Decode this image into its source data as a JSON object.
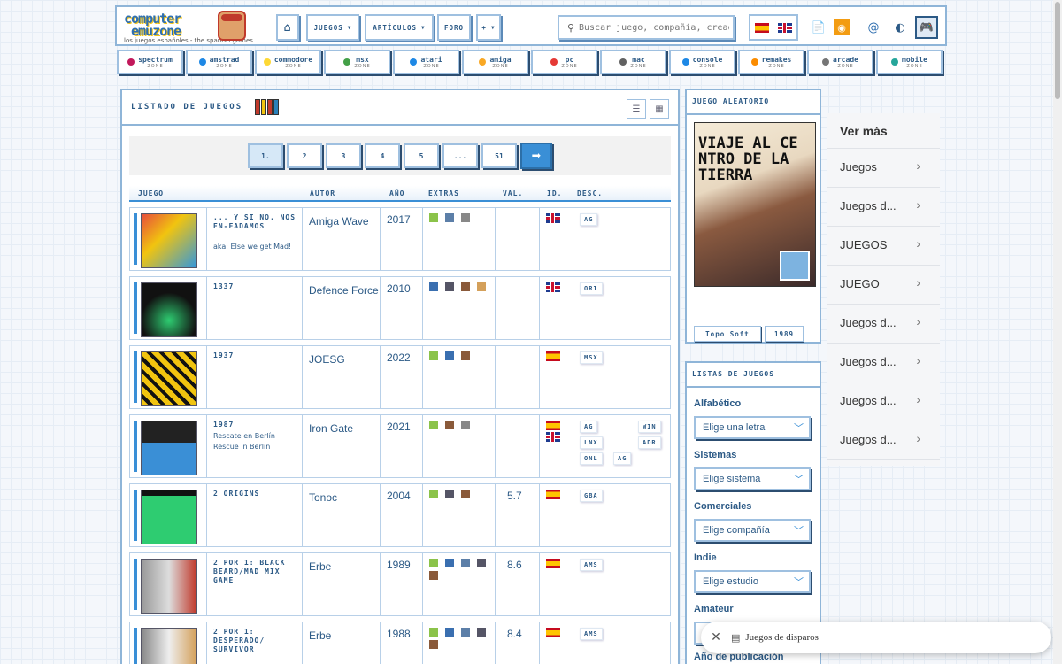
{
  "logo": {
    "line1": "computer",
    "line2": "emuzone",
    "tagline": "los juegos españoles - the spanish games"
  },
  "nav": {
    "home_icon": "home-icon",
    "juegos": "JUEGOS",
    "articulos": "ARTÍCULOS",
    "foro": "FORO",
    "mas": "+"
  },
  "search": {
    "placeholder": "Buscar juego, compañía, creador..."
  },
  "header_icons": [
    "translate-icon",
    "rss-icon",
    "email-icon",
    "contrast-icon",
    "gamepad-icon"
  ],
  "zones": [
    {
      "name": "spectrum",
      "sub": "ZONE",
      "color": "#c2185b"
    },
    {
      "name": "amstrad",
      "sub": "ZONE",
      "color": "#1e88e5"
    },
    {
      "name": "commodore",
      "sub": "ZONE",
      "color": "#fdd835"
    },
    {
      "name": "msx",
      "sub": "ZONE",
      "color": "#43a047"
    },
    {
      "name": "atari",
      "sub": "ZONE",
      "color": "#1e88e5"
    },
    {
      "name": "amiga",
      "sub": "ZONE",
      "color": "#f9a825"
    },
    {
      "name": "pc",
      "sub": "ZONE",
      "color": "#e53935"
    },
    {
      "name": "mac",
      "sub": "ZONE",
      "color": "#616161"
    },
    {
      "name": "console",
      "sub": "ZONE",
      "color": "#1e88e5"
    },
    {
      "name": "remakes",
      "sub": "ZONE",
      "color": "#fb8c00"
    },
    {
      "name": "arcade",
      "sub": "ZONE",
      "color": "#757575"
    },
    {
      "name": "mobile",
      "sub": "ZONE",
      "color": "#26a69a"
    }
  ],
  "main": {
    "title": "LISTADO DE JUEGOS"
  },
  "pager": {
    "pages": [
      "1.",
      "2",
      "3",
      "4",
      "5",
      "...",
      "51"
    ],
    "next": "➡"
  },
  "columns": {
    "juego": "JUEGO",
    "autor": "AUTOR",
    "anio": "AÑO",
    "extras": "EXTRAS",
    "val": "VAL.",
    "id": "ID.",
    "desc": "DESC."
  },
  "games": [
    {
      "title": "... Y SI NO, NOS EN-FADAMOS",
      "aka": "aka: Else we get Mad!",
      "autor": "Amiga Wave",
      "anio": "2017",
      "val": "",
      "flags": [
        "uk"
      ],
      "desc": [
        "AG"
      ],
      "extras": [
        "#8bc34a",
        "#5c7fa8",
        "#888"
      ]
    },
    {
      "title": "1337",
      "aka": "",
      "autor": "Defence Force",
      "anio": "2010",
      "val": "",
      "flags": [
        "uk"
      ],
      "desc": [
        "ORI"
      ],
      "extras": [
        "#3a6fb0",
        "#556",
        "#8a5a3a",
        "#d4a05a"
      ]
    },
    {
      "title": "1937",
      "aka": "",
      "autor": "JOESG",
      "anio": "2022",
      "val": "",
      "flags": [
        "es"
      ],
      "desc": [
        "MSX"
      ],
      "extras": [
        "#8bc34a",
        "#3a6fb0",
        "#8a5a3a"
      ]
    },
    {
      "title": "1987",
      "aka": "Rescate en Berlín\nRescue in Berlin",
      "autor": "Iron Gate",
      "anio": "2021",
      "val": "",
      "flags": [
        "es",
        "uk"
      ],
      "desc": [
        "AG",
        "WIN",
        "LNX",
        "ADR",
        "ONL",
        "AG"
      ],
      "extras": [
        "#8bc34a",
        "#8a5a3a",
        "#888"
      ]
    },
    {
      "title": "2 ORIGINS",
      "aka": "",
      "autor": "Tonoc",
      "anio": "2004",
      "val": "5.7",
      "flags": [
        "es"
      ],
      "desc": [
        "GBA"
      ],
      "extras": [
        "#8bc34a",
        "#556",
        "#8a5a3a"
      ]
    },
    {
      "title": "2 POR 1: BLACK BEARD/MAD MIX GAME",
      "aka": "",
      "autor": "Erbe",
      "anio": "1989",
      "val": "8.6",
      "flags": [
        "es"
      ],
      "desc": [
        "AMS"
      ],
      "extras": [
        "#8bc34a",
        "#3a6fb0",
        "#5c7fa8",
        "#556",
        "#8a5a3a"
      ]
    },
    {
      "title": "2 POR 1: DESPERADO/ SURVIVOR",
      "aka": "",
      "autor": "Erbe",
      "anio": "1988",
      "val": "8.4",
      "flags": [
        "es"
      ],
      "desc": [
        "AMS"
      ],
      "extras": [
        "#8bc34a",
        "#3a6fb0",
        "#5c7fa8",
        "#556",
        "#8a5a3a"
      ]
    }
  ],
  "random": {
    "heading": "JUEGO ALEATORIO",
    "cover_title": "VIAJE AL CENTRO DE LA TIERRA",
    "company": "Topo Soft",
    "year": "1989"
  },
  "lists": {
    "heading": "LISTAS DE JUEGOS",
    "filters": [
      {
        "label": "Alfabético",
        "value": "Elige una letra"
      },
      {
        "label": "Sistemas",
        "value": "Elige sistema"
      },
      {
        "label": "Comerciales",
        "value": "Elige compañía"
      },
      {
        "label": "Indie",
        "value": "Elige estudio"
      },
      {
        "label": "Amateur",
        "value": ""
      }
    ],
    "last_label": "Año de publicación"
  },
  "vermas": {
    "heading": "Ver más",
    "items": [
      "Juegos",
      "Juegos d...",
      "JUEGOS",
      "JUEGO",
      "Juegos d...",
      "Juegos d...",
      "Juegos d...",
      "Juegos d..."
    ]
  },
  "toast": {
    "text": "Juegos de disparos"
  }
}
